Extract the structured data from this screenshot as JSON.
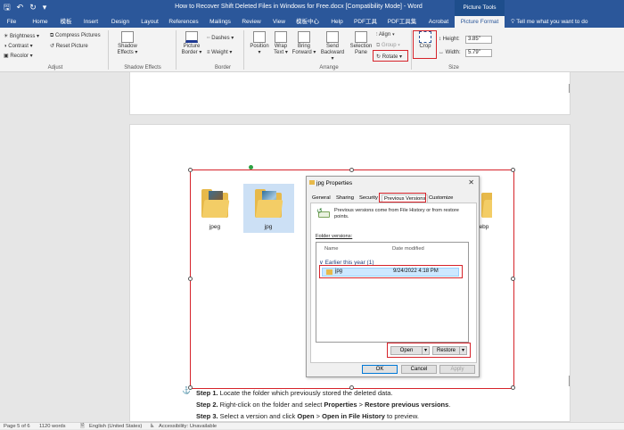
{
  "window": {
    "title": "How to Recover Shift Deleted Files in Windows for Free.docx [Compatibility Mode] - Word",
    "contextual_group": "Picture Tools"
  },
  "qat": {
    "save_icon": "save-icon",
    "undo_icon": "undo-icon",
    "redo_icon": "redo-icon",
    "customize_icon": "customize-icon"
  },
  "tabs": [
    "File",
    "Home",
    "模板",
    "Insert",
    "Design",
    "Layout",
    "References",
    "Mailings",
    "Review",
    "View",
    "模板中心",
    "Help",
    "PDF工具",
    "PDF工具集",
    "Acrobat",
    "Picture Format"
  ],
  "tell_me": "Tell me what you want to do",
  "ribbon": {
    "adjust": {
      "brightness": "Brightness ▾",
      "contrast": "Contrast ▾",
      "recolor": "Recolor ▾",
      "compress": "Compress Pictures",
      "reset": "Reset Picture",
      "label": "Adjust"
    },
    "shadow": {
      "button": "Shadow\nEffects ▾",
      "label": "Shadow Effects"
    },
    "border": {
      "picture_border": "Picture\nBorder ▾",
      "dashes": "Dashes ▾",
      "weight": "Weight ▾",
      "label": "Border"
    },
    "arrange": {
      "position": "Position\n▾",
      "wrap": "Wrap\nText ▾",
      "bring_forward": "Bring\nForward ▾",
      "send_backward": "Send\nBackward ▾",
      "selection_pane": "Selection\nPane",
      "align": "Align ▾",
      "group": "Group ▾",
      "rotate": "Rotate ▾",
      "label": "Arrange"
    },
    "crop": {
      "label": "Crop"
    },
    "size": {
      "height_label": "Height:",
      "height_value": "3.85\"",
      "width_label": "Width:",
      "width_value": "5.79\"",
      "label": "Size"
    }
  },
  "picture": {
    "folders": [
      {
        "label": "jpeg"
      },
      {
        "label": "jpg"
      },
      {
        "label": "ebp"
      }
    ]
  },
  "dialog": {
    "title": "jpg Properties",
    "tabs": [
      "General",
      "Sharing",
      "Security",
      "Previous Versions",
      "Customize"
    ],
    "active_tab": "Previous Versions",
    "info": "Previous versions come from File History or from restore points.",
    "folder_versions_label": "Folder versions:",
    "col_name": "Name",
    "col_date": "Date modified",
    "group": "Earlier this year (1)",
    "row": {
      "name": "jpg",
      "date": "9/24/2022 4:18 PM"
    },
    "open_btn": "Open",
    "restore_btn": "Restore",
    "ok_btn": "OK",
    "cancel_btn": "Cancel",
    "apply_btn": "Apply"
  },
  "steps": [
    {
      "label": "Step 1.",
      "text": " Locate the folder which previously stored the deleted data."
    },
    {
      "label": "Step 2.",
      "text_a": " Right-click on the folder and select ",
      "bold_a": "Properties",
      "text_b": " > ",
      "bold_b": "Restore previous versions",
      "text_c": "."
    },
    {
      "label": "Step 3.",
      "text_a": " Select a version and click ",
      "bold_a": "Open",
      "text_b": " > ",
      "bold_b": "Open in File History",
      "text_c": " to preview."
    }
  ],
  "status": {
    "page": "Page 5 of 6",
    "words": "1120 words",
    "language": "English (United States)",
    "accessibility": "Accessibility: Unavailable"
  },
  "colors": {
    "accent": "#2b579a",
    "highlight": "#d6232a",
    "folder": "#e7b94a"
  }
}
